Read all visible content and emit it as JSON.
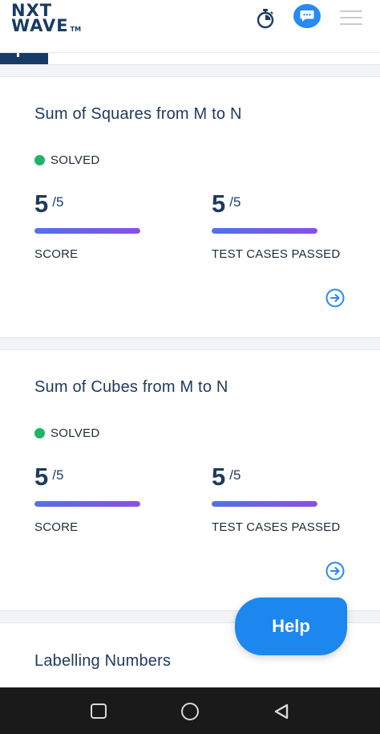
{
  "header": {
    "logo_line1": "NXT",
    "logo_line2": "WAVE",
    "logo_tm": "TM",
    "icons": [
      "stopwatch-icon",
      "chat-icon",
      "hamburger-menu-icon"
    ],
    "accent": "#2789f5"
  },
  "cards": [
    {
      "title": "Sum of Squares from M to N",
      "status": "SOLVED",
      "score": {
        "value": "5",
        "total": "/5",
        "label": "SCORE",
        "progress": 1.0
      },
      "tests": {
        "value": "5",
        "total": "/5",
        "label": "TEST CASES PASSED",
        "progress": 1.0
      }
    },
    {
      "title": "Sum of Cubes from M to N",
      "status": "SOLVED",
      "score": {
        "value": "5",
        "total": "/5",
        "label": "SCORE",
        "progress": 1.0
      },
      "tests": {
        "value": "5",
        "total": "/5",
        "label": "TEST CASES PASSED",
        "progress": 1.0
      }
    },
    {
      "title": "Labelling Numbers"
    }
  ],
  "help_button": {
    "label": "Help"
  },
  "colors": {
    "solved_green": "#1fb36b",
    "title_navy": "#1e3a5f",
    "bar_start": "#4f73e8",
    "bar_end": "#8a4fe6"
  }
}
